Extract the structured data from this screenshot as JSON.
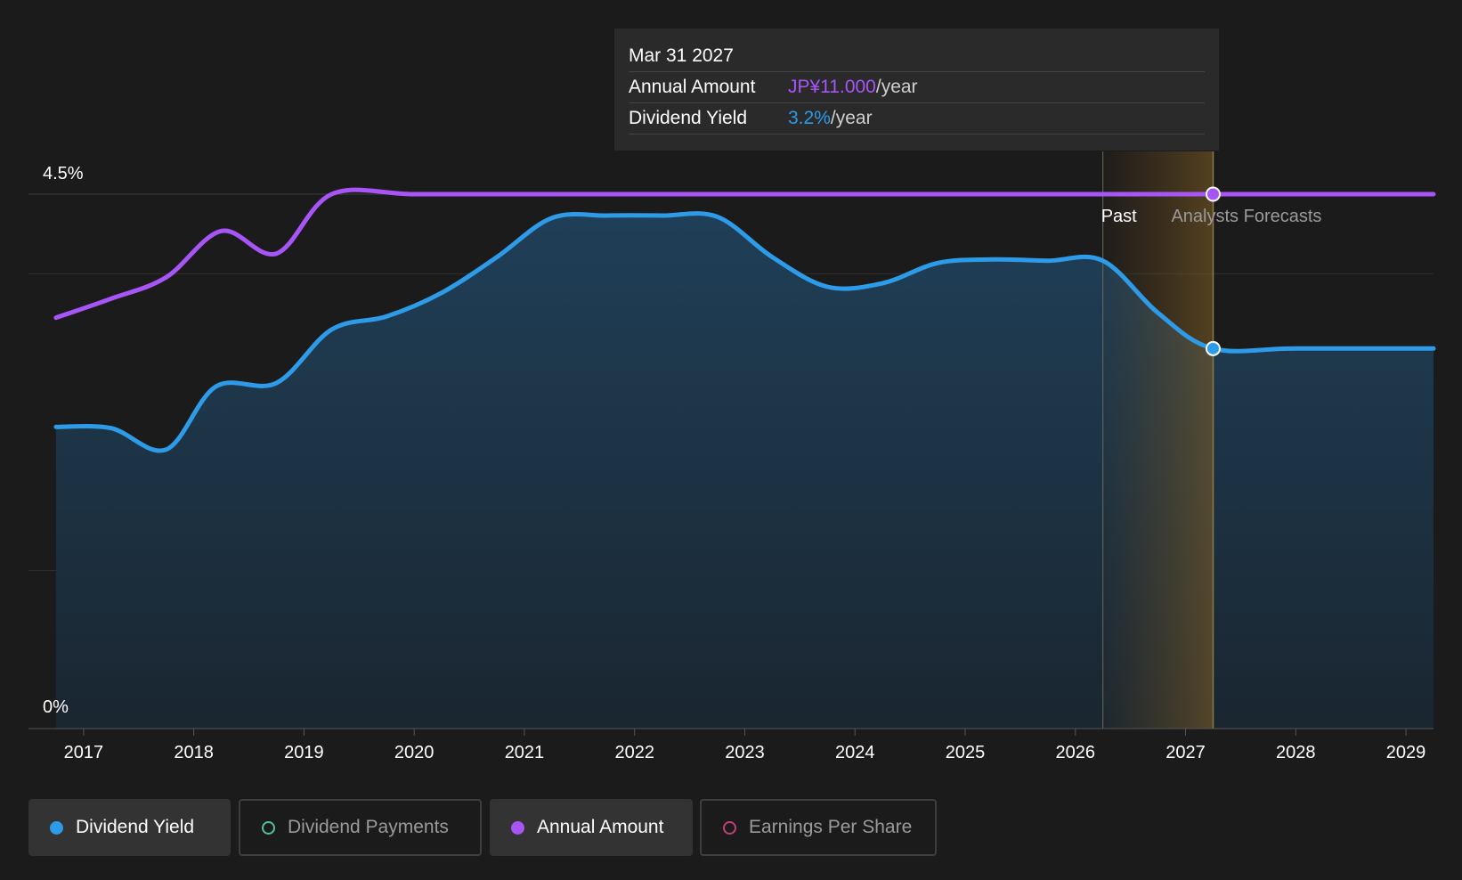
{
  "tooltip": {
    "date": "Mar 31 2027",
    "rows": [
      {
        "label": "Annual Amount",
        "value": "JP¥11.000",
        "unit": "/year"
      },
      {
        "label": "Dividend Yield",
        "value": "3.2%",
        "unit": "/year"
      }
    ]
  },
  "regions": {
    "past": "Past",
    "forecast": "Analysts Forecasts"
  },
  "legend": [
    {
      "label": "Dividend Yield",
      "color": "#2d9be8",
      "active": true
    },
    {
      "label": "Dividend Payments",
      "color": "#4fc3a1",
      "active": false
    },
    {
      "label": "Annual Amount",
      "color": "#a855f7",
      "active": true
    },
    {
      "label": "Earnings Per Share",
      "color": "#c2407a",
      "active": false
    }
  ],
  "chart_data": {
    "type": "line",
    "y_tick_labels": [
      "4.5%",
      "0%"
    ],
    "ylim": [
      0,
      4.5
    ],
    "x_tick_labels": [
      "2017",
      "2018",
      "2019",
      "2020",
      "2021",
      "2022",
      "2023",
      "2024",
      "2025",
      "2026",
      "2027",
      "2028",
      "2029"
    ],
    "xlim": [
      2016.5,
      2029.25
    ],
    "past_end": 2026.25,
    "forecast_marker": 2027.25,
    "series": [
      {
        "name": "Dividend Yield",
        "color": "#2d9be8",
        "points": [
          [
            2016.75,
            2.54
          ],
          [
            2017.25,
            2.53
          ],
          [
            2017.75,
            2.35
          ],
          [
            2018.2,
            2.88
          ],
          [
            2018.75,
            2.91
          ],
          [
            2019.25,
            3.36
          ],
          [
            2019.75,
            3.47
          ],
          [
            2020.25,
            3.67
          ],
          [
            2020.75,
            3.97
          ],
          [
            2021.25,
            4.3
          ],
          [
            2021.75,
            4.32
          ],
          [
            2022.25,
            4.32
          ],
          [
            2022.75,
            4.31
          ],
          [
            2023.25,
            3.97
          ],
          [
            2023.75,
            3.72
          ],
          [
            2024.25,
            3.75
          ],
          [
            2024.75,
            3.92
          ],
          [
            2025.25,
            3.95
          ],
          [
            2025.75,
            3.94
          ],
          [
            2026.25,
            3.94
          ],
          [
            2026.75,
            3.5
          ],
          [
            2027.25,
            3.2
          ],
          [
            2028.0,
            3.2
          ],
          [
            2029.25,
            3.2
          ]
        ]
      },
      {
        "name": "Annual Amount",
        "color": "#a855f7",
        "points": [
          [
            2016.75,
            3.46
          ],
          [
            2017.25,
            3.62
          ],
          [
            2017.75,
            3.8
          ],
          [
            2018.25,
            4.19
          ],
          [
            2018.75,
            4.0
          ],
          [
            2019.25,
            4.5
          ],
          [
            2020.0,
            4.5
          ],
          [
            2021.0,
            4.5
          ],
          [
            2022.0,
            4.5
          ],
          [
            2023.0,
            4.5
          ],
          [
            2024.0,
            4.5
          ],
          [
            2025.0,
            4.5
          ],
          [
            2026.0,
            4.5
          ],
          [
            2027.25,
            4.5
          ],
          [
            2028.0,
            4.5
          ],
          [
            2029.25,
            4.5
          ]
        ]
      }
    ]
  }
}
